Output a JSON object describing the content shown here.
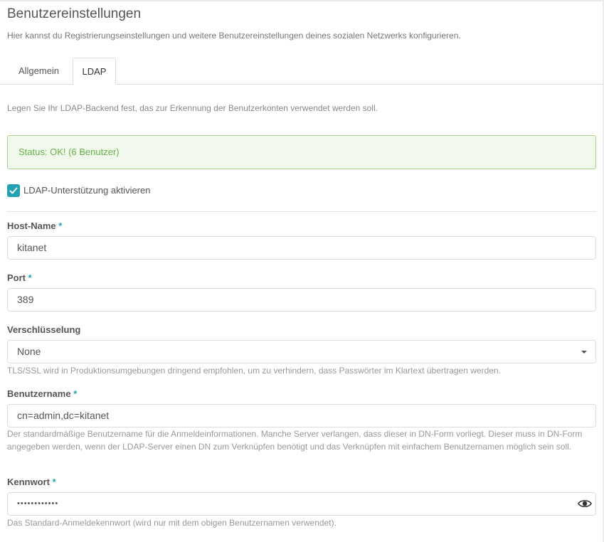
{
  "page": {
    "title": "Benutzereinstellungen",
    "subtitle": "Hier kannst du Registrierungseinstellungen und weitere Benutzereinstellungen deines sozialen Netzwerks konfigurieren."
  },
  "tabs": [
    {
      "label": "Allgemein",
      "active": false
    },
    {
      "label": "LDAP",
      "active": true
    }
  ],
  "intro": "Legen Sie Ihr LDAP-Backend fest, das zur Erkennung der Benutzerkonten verwendet werden soll.",
  "status": "Status: OK! (6 Benutzer)",
  "ldap_enable": {
    "label": "LDAP-Unterstützung aktivieren",
    "checked": true
  },
  "required_marker": "*",
  "fields": {
    "host": {
      "label": "Host-Name",
      "value": "kitanet"
    },
    "port": {
      "label": "Port",
      "value": "389"
    },
    "encryption": {
      "label": "Verschlüsselung",
      "value": "None",
      "hint": "TLS/SSL wird in Produktionsumgebungen dringend empfohlen, um zu verhindern, dass Passwörter im Klartext übertragen werden."
    },
    "username": {
      "label": "Benutzername",
      "value": "cn=admin,dc=kitanet",
      "hint": "Der standardmäßige Benutzername für die Anmeldeinformationen. Manche Server verlangen, dass dieser in DN-Form vorliegt. Dieser muss in DN-Form angegeben werden, wenn der LDAP-Server einen DN zum Verknüpfen benötigt und das Verknüpfen mit einfachem Benutzernamen möglich sein soll."
    },
    "password": {
      "label": "Kennwort",
      "value": "••••••••••••",
      "hint": "Das Standard-Anmeldekennwort (wird nur mit dem obigen Benutzernamen verwendet)."
    }
  },
  "icons": {
    "checkbox": "checkmark-icon",
    "select": "caret-down-icon",
    "password_toggle": "eye-icon"
  },
  "colors": {
    "accent": "#21a1b3",
    "success_border": "#a8d58a",
    "success_bg": "#f0f9ec",
    "success_text": "#6ab04c"
  }
}
